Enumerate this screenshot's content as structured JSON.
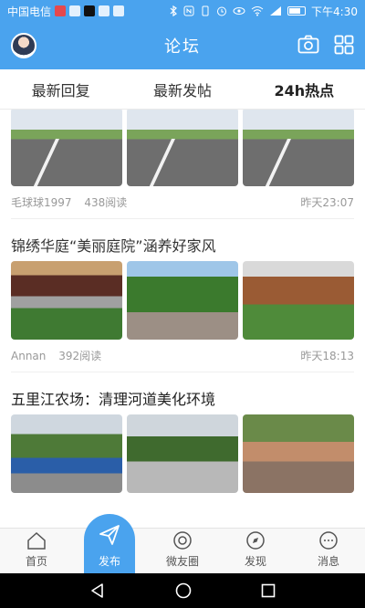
{
  "status_bar": {
    "carrier": "中国电信",
    "time": "下午4:30",
    "icons": [
      "weibo-icon",
      "translate-icon",
      "tiktok-icon",
      "message-icon",
      "app-icon",
      "bluetooth-icon",
      "nfc-icon",
      "vibrate-icon",
      "alarm-icon",
      "eye-icon",
      "wifi-icon",
      "signal-icon",
      "battery-icon"
    ]
  },
  "header": {
    "title": "论坛",
    "accent_color": "#4aa3ee"
  },
  "tabs": [
    {
      "label": "最新回复",
      "active": false
    },
    {
      "label": "最新发帖",
      "active": false
    },
    {
      "label": "24h热点",
      "active": true
    }
  ],
  "posts": [
    {
      "title": "",
      "author": "毛球球1997",
      "reads": "438阅读",
      "time": "昨天23:07"
    },
    {
      "title": "锦绣华庭“美丽庭院”涵养好家风",
      "author": "Annan",
      "reads": "392阅读",
      "time": "昨天18:13"
    },
    {
      "title": "五里江农场：清理河道美化环境",
      "author": "",
      "reads": "",
      "time": ""
    }
  ],
  "bottom_nav": [
    {
      "label": "首页",
      "icon": "home-icon"
    },
    {
      "label": "发布",
      "icon": "paper-plane-icon"
    },
    {
      "label": "微友圈",
      "icon": "moments-icon"
    },
    {
      "label": "发现",
      "icon": "discover-icon"
    },
    {
      "label": "消息",
      "icon": "message-bubble-icon"
    }
  ],
  "system_nav": [
    "back-icon",
    "home-circle-icon",
    "recents-icon"
  ]
}
